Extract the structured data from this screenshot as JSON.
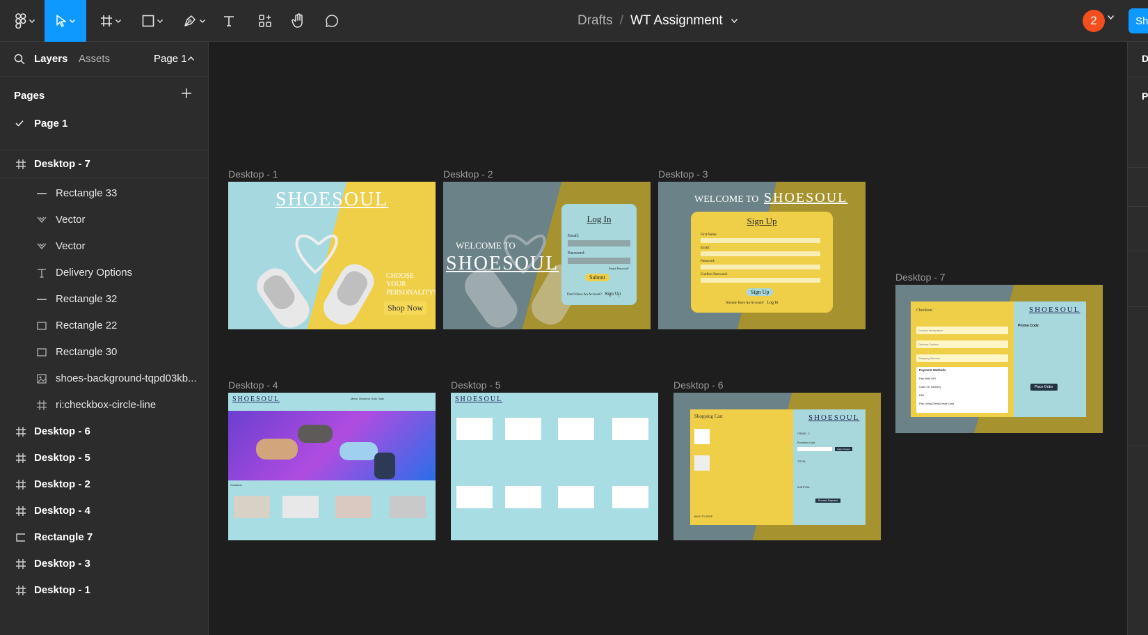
{
  "toolbar": {
    "breadcrumb_root": "Drafts",
    "breadcrumb_sep": "/",
    "file_name": "WT Assignment",
    "avatar_count": "2",
    "share_label": "Share"
  },
  "left_panel": {
    "tabs": {
      "layers": "Layers",
      "assets": "Assets"
    },
    "page_selector": "Page 1",
    "pages_header": "Pages",
    "pages": [
      {
        "label": "Page 1"
      }
    ],
    "sticky_frame": "Desktop - 7",
    "layers": [
      {
        "label": "Rectangle 33",
        "icon": "line-icon"
      },
      {
        "label": "Vector",
        "icon": "vector-icon"
      },
      {
        "label": "Vector",
        "icon": "vector-icon"
      },
      {
        "label": "Delivery Options",
        "icon": "text-icon"
      },
      {
        "label": "Rectangle 32",
        "icon": "line-icon"
      },
      {
        "label": "Rectangle 22",
        "icon": "rectangle-icon"
      },
      {
        "label": "Rectangle 30",
        "icon": "rectangle-icon"
      },
      {
        "label": "shoes-background-tqpd03kb...",
        "icon": "image-icon"
      },
      {
        "label": "ri:checkbox-circle-line",
        "icon": "frame-icon"
      }
    ],
    "frames": [
      {
        "label": "Desktop - 6"
      },
      {
        "label": "Desktop - 5"
      },
      {
        "label": "Desktop - 2"
      },
      {
        "label": "Desktop - 4"
      },
      {
        "label": "Rectangle 7"
      },
      {
        "label": "Desktop - 3"
      },
      {
        "label": "Desktop - 1"
      }
    ]
  },
  "canvas": {
    "frames": {
      "d1": "Desktop - 1",
      "d2": "Desktop - 2",
      "d3": "Desktop - 3",
      "d4": "Desktop - 4",
      "d5": "Desktop - 5",
      "d6": "Desktop - 6",
      "d7": "Desktop - 7"
    },
    "d1": {
      "logo": "SHOESOUL",
      "tagline_1": "CHOOSE",
      "tagline_2": "YOUR",
      "tagline_3": "PERSONALITY!",
      "cta": "Shop Now"
    },
    "d2": {
      "welcome": "WELCOME TO",
      "logo": "SHOESOUL",
      "form_title": "Log In",
      "email": "Email:",
      "password": "Password:",
      "forgot": "Forgot Password?",
      "submit": "Submit",
      "no_account": "Don't Have An Account?",
      "signup_link": "Sign Up"
    },
    "d3": {
      "welcome": "WELCOME TO",
      "logo": "SHOESOUL",
      "form_title": "Sign Up",
      "first_name": "First Name:",
      "email": "Email:",
      "password": "Password:",
      "confirm": "Confirm Password:",
      "button": "Sign Up",
      "have_account": "Already Have An Account?",
      "login_link": "Log In"
    },
    "d4": {
      "logo": "SHOESOUL",
      "nav": "Mens  Womens  Kids  Sale",
      "section": "Sneakers"
    },
    "d5": {
      "logo": "SHOESOUL"
    },
    "d6": {
      "title": "Shopping Cart",
      "logo": "SHOESOUL",
      "items": "ITEMS : 2",
      "promo": "Promotion Code",
      "apply": "Apply Coupon",
      "total": "TOTAL",
      "subtotal": "SUBTOTAL",
      "proceed": "Proceed Payment",
      "back": "BACK TO SHOP"
    },
    "d7": {
      "title": "Checkout",
      "logo": "SHOESOUL",
      "promo": "Promo Code",
      "payment": "Payment Methods",
      "upi": "Pay With UPI",
      "cod": "Cash On Delivery",
      "emi": "EMI",
      "card": "Pay Using Debit/Credit Card",
      "place": "Place Order",
      "contact": "Contact Information",
      "delivery": "Delivery Options",
      "shipping": "Shipping Address"
    }
  },
  "colors": {
    "accent": "#0d99ff",
    "avatar": "#f24e1e",
    "panel": "#2c2c2c",
    "canvas": "#1e1e1e",
    "teal": "#a8d8dc",
    "yellow": "#f0cf48"
  }
}
